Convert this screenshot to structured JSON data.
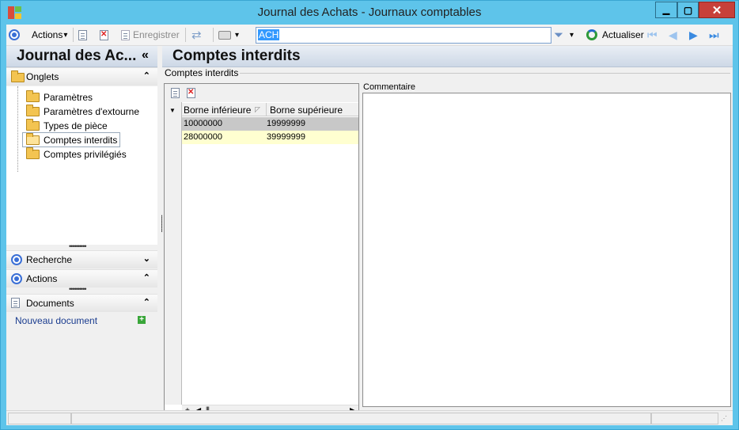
{
  "window": {
    "title": "Journal des Achats -  Journaux comptables",
    "minimize_glyph": "▁",
    "maximize_glyph": "▢",
    "close_glyph": "✕"
  },
  "toolbar": {
    "actions_label": "Actions",
    "save_label": "Enregistrer",
    "search_value": "ACH",
    "refresh_label": "Actualiser",
    "dropdown_glyph": "▾"
  },
  "left_panel": {
    "title": "Journal des Ac...",
    "collapse_glyph": "«",
    "tabs_section": "Onglets",
    "tree_items": [
      {
        "label": "Paramètres"
      },
      {
        "label": "Paramètres d'extourne"
      },
      {
        "label": "Types de pièce"
      },
      {
        "label": "Comptes interdits"
      },
      {
        "label": "Comptes privilégiés"
      }
    ],
    "search_section": "Recherche",
    "actions_section": "Actions",
    "documents_section": "Documents",
    "new_document_link": "Nouveau document",
    "chevron_up": "⌃",
    "chevron_down": "⌄"
  },
  "main": {
    "title": "Comptes interdits",
    "group_label": "Comptes interdits",
    "grid": {
      "columns": [
        "Borne inférieure",
        "Borne supérieure"
      ],
      "rows": [
        [
          "10000000",
          "19999999"
        ],
        [
          "28000000",
          "39999999"
        ]
      ],
      "scroll_plus": "+",
      "scroll_left": "◀",
      "scroll_thumb": "|||",
      "scroll_right": "▶",
      "sort_glyph": "◸",
      "row_indicator": "▼"
    },
    "comment_label": "Commentaire"
  },
  "colors": {
    "window_frame": "#5ec4ea",
    "close_button": "#c7403a",
    "selected_row": "#c8c8c8",
    "alt_row": "#ffffd0",
    "accent_blue": "#3a6fd6"
  }
}
